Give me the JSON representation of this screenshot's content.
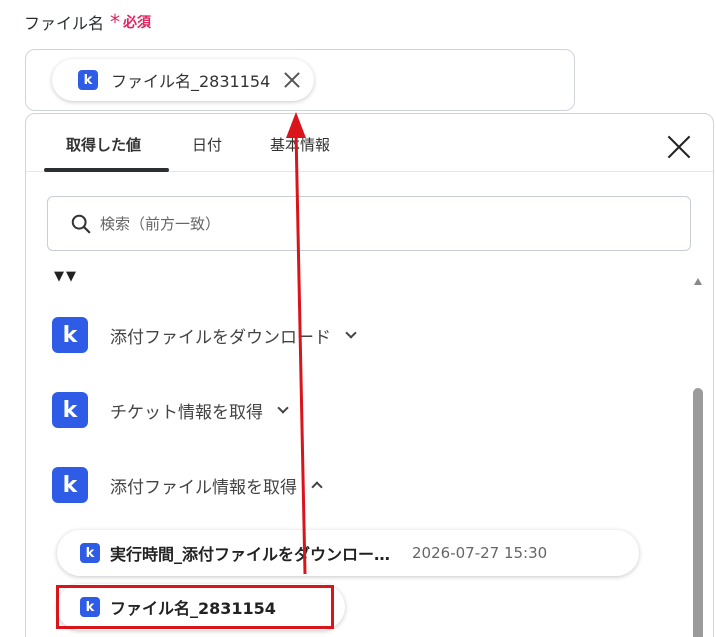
{
  "field": {
    "label": "ファイル名",
    "required_star": "*",
    "required_text": "必須",
    "chip": {
      "icon": "k-icon",
      "text": "ファイル名_2831154"
    }
  },
  "panel": {
    "tabs": [
      {
        "label": "取得した値",
        "active": true
      },
      {
        "label": "日付",
        "active": false
      },
      {
        "label": "基本情報",
        "active": false
      }
    ],
    "search": {
      "placeholder": "検索（前方一致）",
      "value": ""
    },
    "collapse_glyph": "▼▼",
    "sections": [
      {
        "label": "添付ファイルをダウンロード",
        "expanded": false
      },
      {
        "label": "チケット情報を取得",
        "expanded": false
      },
      {
        "label": "添付ファイル情報を取得",
        "expanded": true
      }
    ],
    "items": [
      {
        "label": "実行時間_添付ファイルをダウンロー…",
        "value": "2026-07-27 15:30"
      },
      {
        "label": "ファイル名_2831154",
        "value": ""
      }
    ]
  },
  "colors": {
    "brand": "#2e5ce6",
    "required": "#e0245e",
    "annotation": "#d9141b"
  }
}
